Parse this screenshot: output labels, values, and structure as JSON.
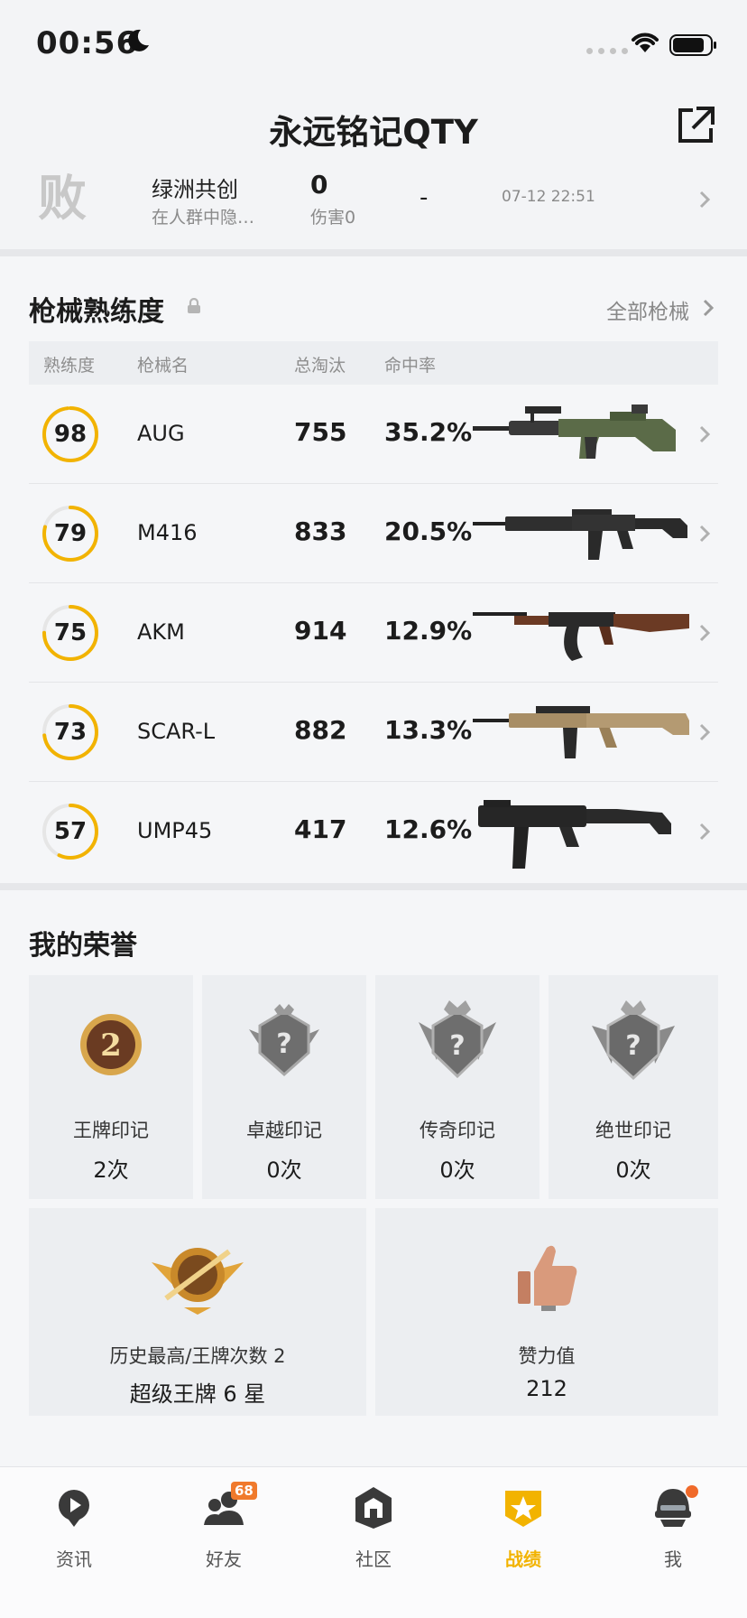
{
  "status_bar": {
    "time": "00:56"
  },
  "header": {
    "title": "永远铭记QTY"
  },
  "recent_match": {
    "result": "败",
    "map": "绿洲共创",
    "mode": "在人群中隐…",
    "kills": "0",
    "damage": "伤害0",
    "rank": "-",
    "date": "07-12 22:51"
  },
  "weapons_section": {
    "title": "枪械熟练度",
    "link": "全部枪械",
    "columns": [
      "熟练度",
      "枪械名",
      "总淘汰",
      "命中率"
    ],
    "rows": [
      {
        "mastery": "98",
        "mastery_value": 98,
        "name": "AUG",
        "kills": "755",
        "accuracy": "35.2%"
      },
      {
        "mastery": "79",
        "mastery_value": 79,
        "name": "M416",
        "kills": "833",
        "accuracy": "20.5%"
      },
      {
        "mastery": "75",
        "mastery_value": 75,
        "name": "AKM",
        "kills": "914",
        "accuracy": "12.9%"
      },
      {
        "mastery": "73",
        "mastery_value": 73,
        "name": "SCAR-L",
        "kills": "882",
        "accuracy": "13.3%"
      },
      {
        "mastery": "57",
        "mastery_value": 57,
        "name": "UMP45",
        "kills": "417",
        "accuracy": "12.6%"
      }
    ]
  },
  "honors_section": {
    "title": "我的荣誉",
    "marks": [
      {
        "label": "王牌印记",
        "count": "2次"
      },
      {
        "label": "卓越印记",
        "count": "0次"
      },
      {
        "label": "传奇印记",
        "count": "0次"
      },
      {
        "label": "绝世印记",
        "count": "0次"
      }
    ],
    "best": {
      "label": "历史最高/王牌次数 2",
      "value": "超级王牌 6 星"
    },
    "likes": {
      "label": "赞力值",
      "value": "212"
    }
  },
  "tab_bar": {
    "tabs": [
      {
        "label": "资讯",
        "icon": "news-icon"
      },
      {
        "label": "好友",
        "icon": "friends-icon",
        "badge": "68"
      },
      {
        "label": "社区",
        "icon": "community-icon"
      },
      {
        "label": "战绩",
        "icon": "record-icon",
        "active": true
      },
      {
        "label": "我",
        "icon": "profile-icon"
      }
    ]
  },
  "colors": {
    "accent": "#f2b300",
    "ring_track": "#e6e6e6",
    "notification": "#f07a2c"
  }
}
